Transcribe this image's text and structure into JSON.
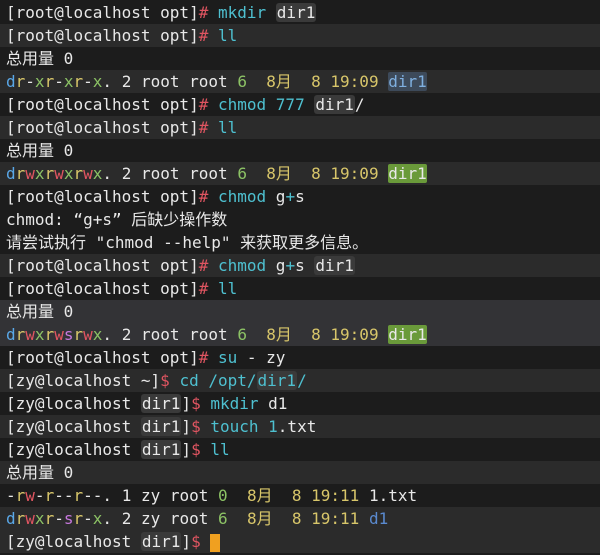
{
  "lines": [
    {
      "kind": "root-cmd",
      "user": "root",
      "host": "localhost",
      "dir": "opt",
      "cmd": "mkdir",
      "arg": "dir1",
      "arg_style": "hi"
    },
    {
      "kind": "root-cmd",
      "user": "root",
      "host": "localhost",
      "dir": "opt",
      "cmd": "ll",
      "arg": "",
      "arg_style": ""
    },
    {
      "kind": "text",
      "text": "总用量 0"
    },
    {
      "kind": "ls",
      "perm": "dr-xr-xr-x.",
      "links": "2",
      "owner": "root",
      "group": "root",
      "size": "6",
      "month": "8月",
      "day": "8",
      "time": "19:09",
      "name": "dir1",
      "name_style": "dirlink"
    },
    {
      "kind": "root-cmd",
      "user": "root",
      "host": "localhost",
      "dir": "opt",
      "cmd": "chmod",
      "arg": "777",
      "arg2": "dir1",
      "arg2_suffix": "/",
      "arg_style": "hi"
    },
    {
      "kind": "root-cmd",
      "user": "root",
      "host": "localhost",
      "dir": "opt",
      "cmd": "ll",
      "arg": "",
      "arg_style": ""
    },
    {
      "kind": "text",
      "text": "总用量 0"
    },
    {
      "kind": "ls",
      "perm": "drwxrwxrwx.",
      "links": "2",
      "owner": "root",
      "group": "root",
      "size": "6",
      "month": "8月",
      "day": "8",
      "time": "19:09",
      "name": "dir1",
      "name_style": "dirlink-g"
    },
    {
      "kind": "root-cmd",
      "user": "root",
      "host": "localhost",
      "dir": "opt",
      "cmd": "chmod",
      "arg": "g+s",
      "arg_style": ""
    },
    {
      "kind": "text",
      "text": "chmod: “g+s” 后缺少操作数"
    },
    {
      "kind": "text",
      "text": "请尝试执行 \"chmod --help\" 来获取更多信息。"
    },
    {
      "kind": "root-cmd",
      "user": "root",
      "host": "localhost",
      "dir": "opt",
      "cmd": "chmod",
      "arg": "g+s",
      "arg2": "dir1",
      "arg2_suffix": "",
      "arg_style": "hi"
    },
    {
      "kind": "root-cmd",
      "user": "root",
      "host": "localhost",
      "dir": "opt",
      "cmd": "ll",
      "arg": "",
      "arg_style": ""
    },
    {
      "kind": "text",
      "text": "总用量 0"
    },
    {
      "kind": "ls",
      "perm": "drwxrwsrwx.",
      "links": "2",
      "owner": "root",
      "group": "root",
      "size": "6",
      "month": "8月",
      "day": "8",
      "time": "19:09",
      "name": "dir1",
      "name_style": "dirlink-g"
    },
    {
      "kind": "root-cmd",
      "user": "root",
      "host": "localhost",
      "dir": "opt",
      "cmd": "su",
      "arg": "- zy",
      "arg_style": ""
    },
    {
      "kind": "zy-cmd",
      "user": "zy",
      "host": "localhost",
      "dir": "~",
      "cmd": "cd",
      "arg": "/opt/dir1/",
      "arg_style": ""
    },
    {
      "kind": "zy-cmd",
      "user": "zy",
      "host": "localhost",
      "dir": "dir1",
      "cmd": "mkdir",
      "arg": "d1",
      "arg_style": ""
    },
    {
      "kind": "zy-cmd",
      "user": "zy",
      "host": "localhost",
      "dir": "dir1",
      "cmd": "touch",
      "arg": "1.txt",
      "arg_style": ""
    },
    {
      "kind": "zy-cmd",
      "user": "zy",
      "host": "localhost",
      "dir": "dir1",
      "cmd": "ll",
      "arg": "",
      "arg_style": ""
    },
    {
      "kind": "text",
      "text": "总用量 0"
    },
    {
      "kind": "ls",
      "perm": "-rw-r--r--.",
      "links": "1",
      "owner": "zy",
      "group": "root",
      "size": "0",
      "month": "8月",
      "day": "8",
      "time": "19:11",
      "name": "1.txt",
      "name_style": "plain"
    },
    {
      "kind": "ls",
      "perm": "drwxr-sr-x.",
      "links": "2",
      "owner": "zy",
      "group": "root",
      "size": "6",
      "month": "8月",
      "day": "8",
      "time": "19:11",
      "name": "d1",
      "name_style": "dirplain"
    },
    {
      "kind": "zy-prompt",
      "user": "zy",
      "host": "localhost",
      "dir": "dir1"
    }
  ],
  "colors": {
    "background": "#1c1c1c",
    "cursor": "#f0a020",
    "command": "#4ec0d0"
  }
}
